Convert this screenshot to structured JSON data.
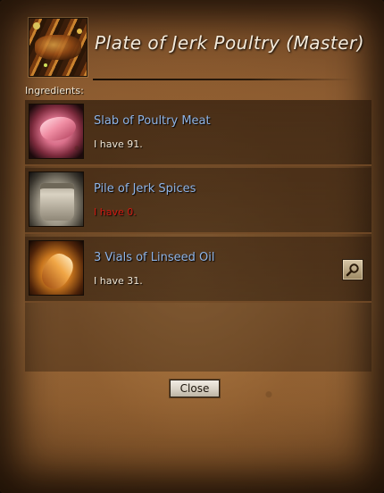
{
  "window": {
    "title": "Plate of Jerk Poultry (Master)",
    "recipe_icon": "plate-of-jerk-poultry-icon"
  },
  "ingredients_label": "Ingredients:",
  "ingredients": [
    {
      "name": "Slab of Poultry Meat",
      "count_text": "I have 91.",
      "icon": "poultry-meat-icon",
      "missing": false
    },
    {
      "name": "Pile of Jerk Spices",
      "count_text": "I have 0.",
      "icon": "spice-bag-icon",
      "missing": true
    },
    {
      "name": "3 Vials of Linseed Oil",
      "count_text": "I have 31.",
      "icon": "linseed-oil-vial-icon",
      "missing": false
    }
  ],
  "buttons": {
    "close_label": "Close",
    "search_icon": "magnifier-icon"
  },
  "colors": {
    "item_name": "#8fb4e6",
    "missing_count": "#d21a12",
    "owned_count": "#f1e7d6"
  }
}
